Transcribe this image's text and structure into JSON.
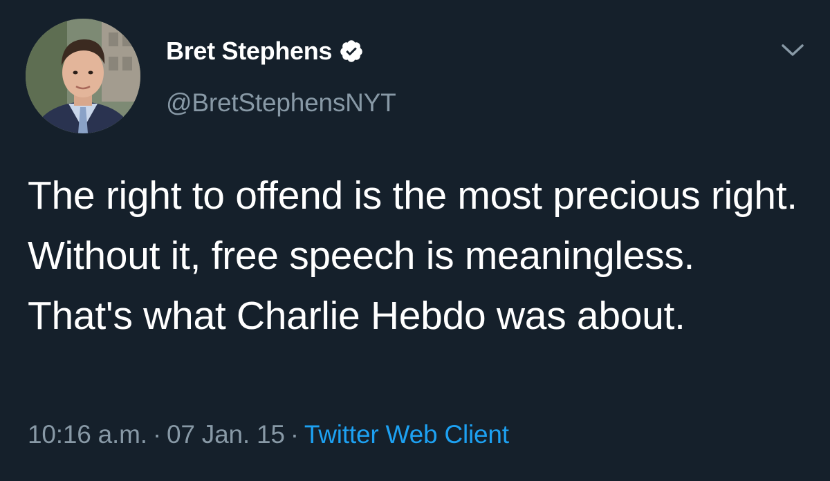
{
  "author": {
    "display_name": "Bret Stephens",
    "handle": "@BretStephensNYT",
    "avatar_icon": "profile-photo",
    "verified_icon": "verified-badge-icon"
  },
  "tweet": {
    "text": "The right to offend is the most precious right. Without it, free speech is meaningless. That's what Charlie Hebdo was about.",
    "time": "10:16 a.m.",
    "separator": "·",
    "date": "07 Jan. 15",
    "source": "Twitter Web Client"
  },
  "menu": {
    "icon": "chevron-down-icon"
  },
  "colors": {
    "background": "#15202b",
    "text_primary": "#ffffff",
    "text_secondary": "#8899a6",
    "link": "#1da1f2"
  }
}
